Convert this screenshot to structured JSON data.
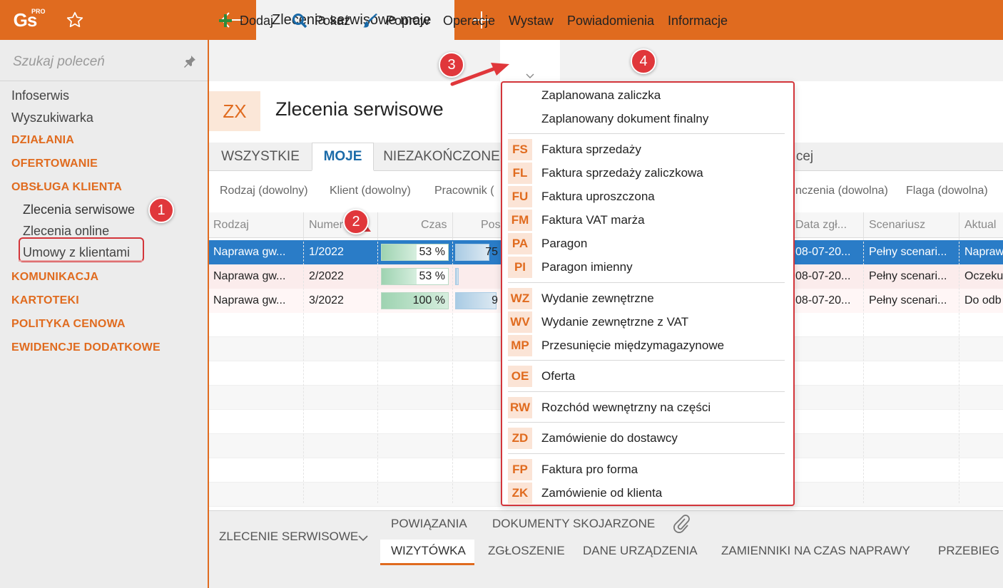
{
  "topbar": {
    "logo": "Gs",
    "logo_badge": "PRO",
    "active_tab": "Zlecenia serwisowe moje"
  },
  "sidebar": {
    "search_placeholder": "Szukaj poleceń",
    "items": [
      {
        "label": "Infoserwis",
        "type": "item"
      },
      {
        "label": "Wyszukiwarka",
        "type": "item"
      },
      {
        "label": "DZIAŁANIA",
        "type": "section"
      },
      {
        "label": "OFERTOWANIE",
        "type": "section"
      },
      {
        "label": "OBSŁUGA KLIENTA",
        "type": "section"
      },
      {
        "label": "Zlecenia serwisowe",
        "type": "sub"
      },
      {
        "label": "Zlecenia online",
        "type": "sub"
      },
      {
        "label": "Umowy z klientami",
        "type": "sub"
      },
      {
        "label": "KOMUNIKACJA",
        "type": "section"
      },
      {
        "label": "KARTOTEKI",
        "type": "section"
      },
      {
        "label": "POLITYKA CENOWA",
        "type": "section"
      },
      {
        "label": "EWIDENCJE DODATKOWE",
        "type": "section"
      }
    ]
  },
  "toolbar": {
    "add": "Dodaj",
    "show": "Pokaż",
    "edit": "Popraw",
    "operations": "Operacje",
    "issue": "Wystaw",
    "notifications": "Powiadomienia",
    "info": "Informacje"
  },
  "header": {
    "code": "ZX",
    "title": "Zlecenia serwisowe"
  },
  "tabs": [
    "WSZYSTKIE",
    "MOJE",
    "NIEZAKOŃCZONE",
    "cej"
  ],
  "filters": [
    "Rodzaj (dowolny)",
    "Klient (dowolny)",
    "Pracownik (",
    "nczenia (dowolna)",
    "Flaga (dowolna)"
  ],
  "grid": {
    "columns": [
      "Rodzaj",
      "Numer",
      "Czas",
      "Pos",
      "Data zgł...",
      "Scenariusz",
      "Aktual"
    ],
    "rows": [
      {
        "rodzaj": "Naprawa gw...",
        "numer": "1/2022",
        "czas": "53 %",
        "czas_pct": 0.53,
        "pos": "75",
        "pos_pct": 0.75,
        "data": "08-07-20...",
        "scenariusz": "Pełny scenari...",
        "aktual": "Napraw"
      },
      {
        "rodzaj": "Naprawa gw...",
        "numer": "2/2022",
        "czas": "53 %",
        "czas_pct": 0.53,
        "pos": "",
        "pos_pct": 0.08,
        "data": "08-07-20...",
        "scenariusz": "Pełny scenari...",
        "aktual": "Oczeku"
      },
      {
        "rodzaj": "Naprawa gw...",
        "numer": "3/2022",
        "czas": "100 %",
        "czas_pct": 1.0,
        "pos": "9",
        "pos_pct": 0.9,
        "data": "08-07-20...",
        "scenariusz": "Pełny scenari...",
        "aktual": "Do odb"
      }
    ]
  },
  "bottom": {
    "section": "ZLECENIE SERWISOWE",
    "tabs_top": [
      "POWIĄZANIA",
      "DOKUMENTY SKOJARZONE"
    ],
    "tabs": [
      "WIZYTÓWKA",
      "ZGŁOSZENIE",
      "DANE URZĄDZENIA",
      "ZAMIENNIKI NA CZAS NAPRAWY",
      "PRZEBIEG"
    ]
  },
  "dropdown": {
    "groups": [
      [
        {
          "code": "",
          "label": "Zaplanowana zaliczka"
        },
        {
          "code": "",
          "label": "Zaplanowany dokument finalny"
        }
      ],
      [
        {
          "code": "FS",
          "label": "Faktura sprzedaży"
        },
        {
          "code": "FL",
          "label": "Faktura sprzedaży zaliczkowa"
        },
        {
          "code": "FU",
          "label": "Faktura uproszczona"
        },
        {
          "code": "FM",
          "label": "Faktura VAT marża"
        },
        {
          "code": "PA",
          "label": "Paragon"
        },
        {
          "code": "PI",
          "label": "Paragon imienny"
        }
      ],
      [
        {
          "code": "WZ",
          "label": "Wydanie zewnętrzne"
        },
        {
          "code": "WV",
          "label": "Wydanie zewnętrzne z VAT"
        },
        {
          "code": "MP",
          "label": "Przesunięcie międzymagazynowe"
        }
      ],
      [
        {
          "code": "OE",
          "label": "Oferta"
        }
      ],
      [
        {
          "code": "RW",
          "label": "Rozchód wewnętrzny na części"
        }
      ],
      [
        {
          "code": "ZD",
          "label": "Zamówienie do dostawcy"
        }
      ],
      [
        {
          "code": "FP",
          "label": "Faktura pro forma"
        },
        {
          "code": "ZK",
          "label": "Zamówienie od klienta"
        }
      ]
    ]
  },
  "markers": [
    "1",
    "2",
    "3",
    "4"
  ],
  "colors": {
    "accent": "#e06b1f",
    "selection": "#2a7cc7",
    "marker": "#e0373b"
  }
}
